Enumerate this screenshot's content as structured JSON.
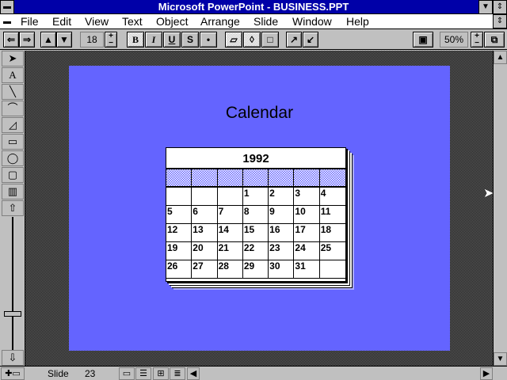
{
  "window": {
    "title": "Microsoft PowerPoint - BUSINESS.PPT"
  },
  "menu": [
    "File",
    "Edit",
    "View",
    "Text",
    "Object",
    "Arrange",
    "Slide",
    "Window",
    "Help"
  ],
  "toolbar": {
    "font_size": "18",
    "bold": "B",
    "italic": "I",
    "underline": "U",
    "shadow": "S",
    "bullet": "•",
    "zoom": "50%"
  },
  "slide": {
    "title": "Calendar",
    "calendar": {
      "year": "1992",
      "days": [
        "",
        "",
        "",
        "1",
        "2",
        "3",
        "4",
        "5",
        "6",
        "7",
        "8",
        "9",
        "10",
        "11",
        "12",
        "13",
        "14",
        "15",
        "16",
        "17",
        "18",
        "19",
        "20",
        "21",
        "22",
        "23",
        "24",
        "25",
        "26",
        "27",
        "28",
        "29",
        "30",
        "31",
        ""
      ]
    }
  },
  "status": {
    "label": "Slide",
    "number": "23"
  }
}
